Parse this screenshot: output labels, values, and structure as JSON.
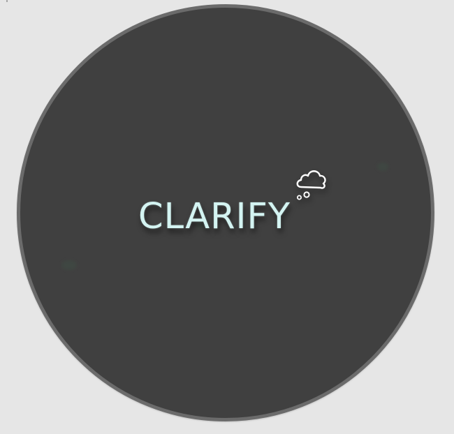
{
  "brand": {
    "name": "CLARIFY",
    "logo_icon": "thought-cloud-icon",
    "text_color": "#d4f4f2"
  },
  "colors": {
    "background": "#e6e6e6",
    "disc_fill": "#404040",
    "disc_border": "#6b6b6b"
  }
}
